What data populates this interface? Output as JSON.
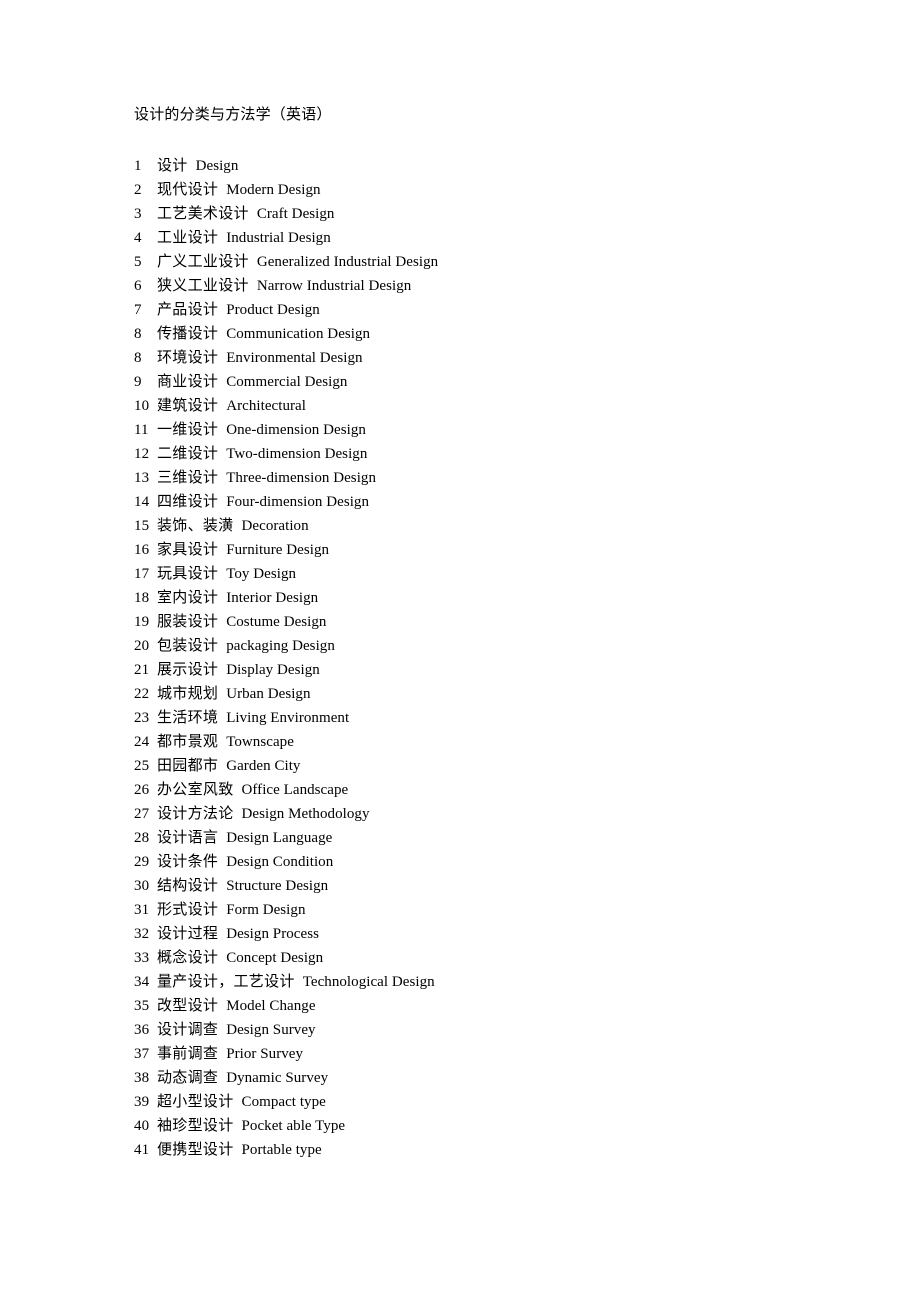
{
  "document": {
    "title": "设计的分类与方法学（英语）",
    "entries": [
      {
        "num": "1",
        "cn": "设计",
        "en": "Design"
      },
      {
        "num": "2",
        "cn": "现代设计",
        "en": "Modern Design"
      },
      {
        "num": "3",
        "cn": "工艺美术设计",
        "en": "Craft Design"
      },
      {
        "num": "4",
        "cn": "工业设计",
        "en": "Industrial Design"
      },
      {
        "num": "5",
        "cn": "广义工业设计",
        "en": "Generalized Industrial Design"
      },
      {
        "num": "6",
        "cn": "狭义工业设计",
        "en": "Narrow Industrial Design"
      },
      {
        "num": "7",
        "cn": "产品设计",
        "en": "Product Design"
      },
      {
        "num": "8",
        "cn": "传播设计",
        "en": "Communication Design"
      },
      {
        "num": "8",
        "cn": "环境设计",
        "en": "Environmental Design"
      },
      {
        "num": "9",
        "cn": "商业设计",
        "en": "Commercial Design"
      },
      {
        "num": "10",
        "cn": "建筑设计",
        "en": "Architectural"
      },
      {
        "num": "11",
        "cn": "一维设计",
        "en": "One-dimension Design"
      },
      {
        "num": "12",
        "cn": "二维设计",
        "en": "Two-dimension Design"
      },
      {
        "num": "13",
        "cn": "三维设计",
        "en": "Three-dimension Design"
      },
      {
        "num": "14",
        "cn": "四维设计",
        "en": "Four-dimension Design"
      },
      {
        "num": "15",
        "cn": "装饰、装潢",
        "en": "Decoration"
      },
      {
        "num": "16",
        "cn": "家具设计",
        "en": "Furniture Design"
      },
      {
        "num": "17",
        "cn": "玩具设计",
        "en": "Toy Design"
      },
      {
        "num": "18",
        "cn": "室内设计",
        "en": "Interior Design"
      },
      {
        "num": "19",
        "cn": "服装设计",
        "en": "Costume Design"
      },
      {
        "num": "20",
        "cn": "包装设计",
        "en": "packaging Design"
      },
      {
        "num": "21",
        "cn": "展示设计",
        "en": "Display Design"
      },
      {
        "num": "22",
        "cn": "城市规划",
        "en": "Urban Design"
      },
      {
        "num": "23",
        "cn": "生活环境",
        "en": "Living Environment"
      },
      {
        "num": "24",
        "cn": "都市景观",
        "en": "Townscape"
      },
      {
        "num": "25",
        "cn": "田园都市",
        "en": "Garden City"
      },
      {
        "num": "26",
        "cn": "办公室风致",
        "en": "Office Landscape"
      },
      {
        "num": "27",
        "cn": "设计方法论",
        "en": "Design Methodology"
      },
      {
        "num": "28",
        "cn": "设计语言",
        "en": "Design Language"
      },
      {
        "num": "29",
        "cn": "设计条件",
        "en": "Design Condition"
      },
      {
        "num": "30",
        "cn": "结构设计",
        "en": "Structure Design"
      },
      {
        "num": "31",
        "cn": "形式设计",
        "en": "Form Design"
      },
      {
        "num": "32",
        "cn": "设计过程",
        "en": "Design Process"
      },
      {
        "num": "33",
        "cn": "概念设计",
        "en": "Concept Design"
      },
      {
        "num": "34",
        "cn": "量产设计，工艺设计",
        "en": "Technological Design"
      },
      {
        "num": "35",
        "cn": "改型设计",
        "en": "Model Change"
      },
      {
        "num": "36",
        "cn": "设计调查",
        "en": "Design Survey"
      },
      {
        "num": "37",
        "cn": "事前调查",
        "en": "Prior Survey"
      },
      {
        "num": "38",
        "cn": "动态调查",
        "en": "Dynamic Survey"
      },
      {
        "num": "39",
        "cn": "超小型设计",
        "en": "Compact type"
      },
      {
        "num": "40",
        "cn": "袖珍型设计",
        "en": "Pocket able Type"
      },
      {
        "num": "41",
        "cn": "便携型设计",
        "en": "Portable type"
      }
    ]
  },
  "style": {
    "text_color": "#000000",
    "page_background": "#ffffff"
  }
}
